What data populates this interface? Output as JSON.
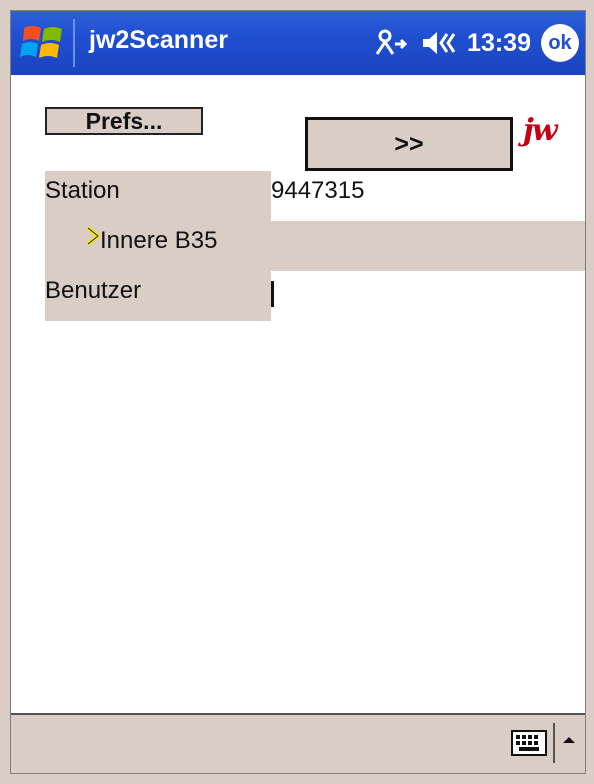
{
  "titlebar": {
    "app_title": "jw2Scanner",
    "clock": "13:39",
    "ok_label": "ok",
    "icons": [
      "windows-start-icon",
      "connectivity-icon",
      "volume-icon"
    ]
  },
  "toolbar": {
    "prefs_label": "Prefs...",
    "go_label": ">>",
    "logo_text": "jw"
  },
  "form": {
    "station_label": "Station",
    "station_value": "9447315",
    "selected_item": "Innere B35",
    "user_label": "Benutzer",
    "user_value": ""
  },
  "bottombar": {
    "icons": [
      "keyboard-icon",
      "sip-arrow-up-icon"
    ]
  },
  "colors": {
    "titlebar_blue": "#1f4fd0",
    "panel_beige": "#d9cdc6",
    "logo_red": "#c40012",
    "arrow_yellow": "#ffe600"
  }
}
